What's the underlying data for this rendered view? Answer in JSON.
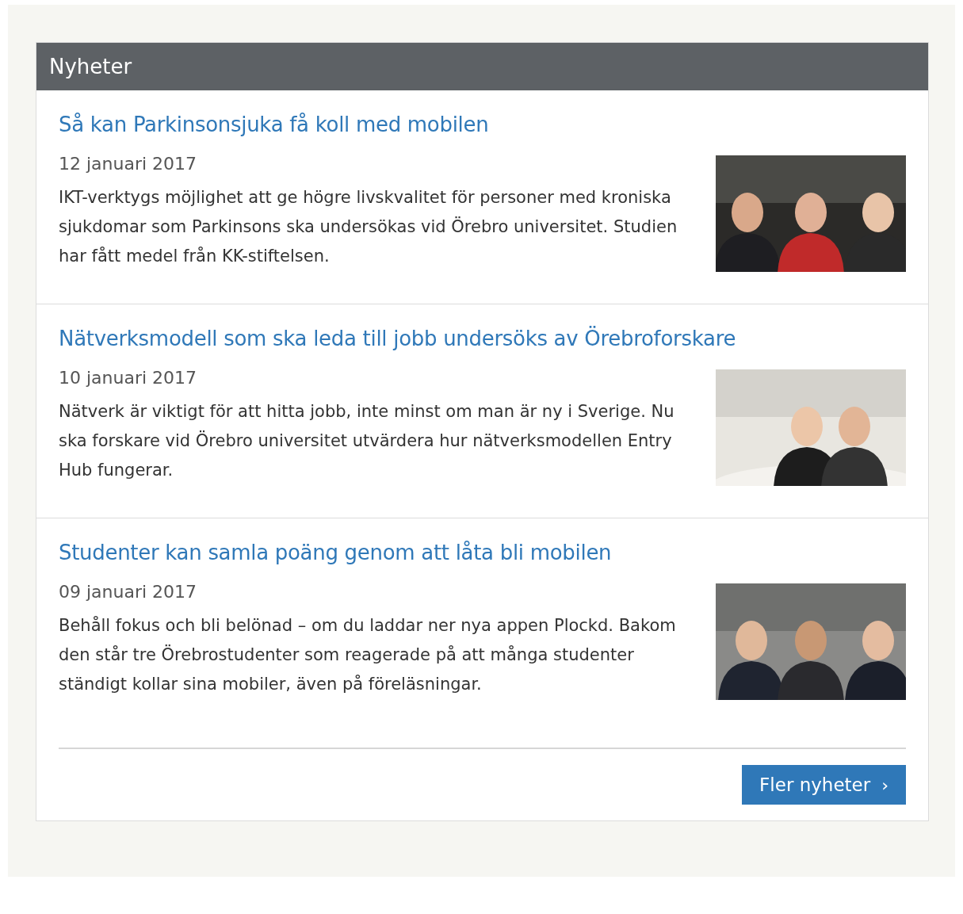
{
  "panel": {
    "title": "Nyheter"
  },
  "news": [
    {
      "headline": "Så kan Parkinsonsjuka få koll med mobilen",
      "date": "12 januari 2017",
      "summary": "IKT-verktygs möjlighet att ge högre livskvalitet för personer med kroniska sjukdomar som Parkinsons ska undersökas vid Örebro universitet. Studien har fått medel från KK-stiftelsen."
    },
    {
      "headline": "Nätverksmodell som ska leda till jobb undersöks av Örebroforskare",
      "date": "10 januari 2017",
      "summary": "Nätverk är viktigt för att hitta jobb, inte minst om man är ny i Sverige. Nu ska forskare vid Örebro universitet utvärdera hur nätverksmodellen Entry Hub fungerar."
    },
    {
      "headline": "Studenter kan samla poäng genom att låta bli mobilen",
      "date": "09 januari 2017",
      "summary": "Behåll fokus och bli belönad – om du laddar ner nya appen Plockd. Bakom den står tre Örebrostudenter som reagerade på att många studenter ständigt kollar sina mobiler, även på föreläsningar."
    }
  ],
  "more_button": {
    "label": "Fler nyheter",
    "icon": "›"
  }
}
